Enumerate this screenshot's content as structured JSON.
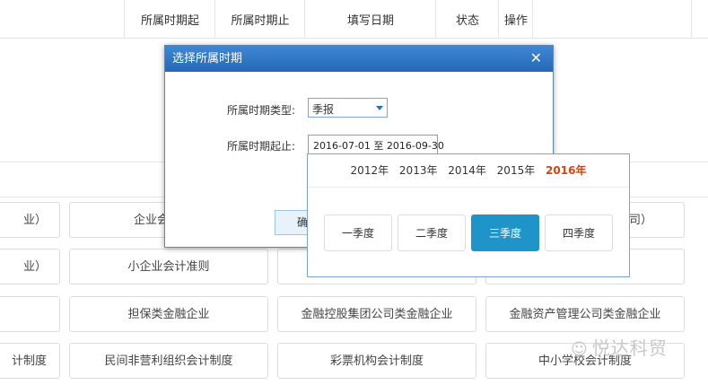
{
  "table_header": {
    "col_start": "所属时期起",
    "col_end": "所属时期止",
    "col_fill_date": "填写日期",
    "col_status": "状态",
    "col_action": "操作"
  },
  "grid": {
    "row1": [
      "业）",
      "企业会计准则",
      "",
      "司）"
    ],
    "row2": [
      "业）",
      "小企业会计准则",
      "",
      ""
    ],
    "row3": [
      "",
      "担保类金融企业",
      "金融控股集团公司类金融企业",
      "金融资产管理公司类金融企业"
    ],
    "row4": [
      "计制度",
      "民间非营利组织会计制度",
      "彩票机构会计制度",
      "中小学校会计制度"
    ]
  },
  "watermark": {
    "text": "悦达科贸"
  },
  "dialog": {
    "title": "选择所属时期",
    "close_label": "✕",
    "period_type_label": "所属时期类型:",
    "period_type_value": "季报",
    "period_range_label": "所属时期起止:",
    "period_range_value": "2016-07-01 至 2016-09-30",
    "confirm_label": "确"
  },
  "quarter_picker": {
    "years": [
      "2012年",
      "2013年",
      "2014年",
      "2015年",
      "2016年"
    ],
    "selected_year": "2016年",
    "quarters": [
      "一季度",
      "二季度",
      "三季度",
      "四季度"
    ],
    "selected_quarter": "三季度"
  },
  "colors": {
    "title_bar": "#2c72c4",
    "active_quarter": "#1f94c9",
    "active_year": "#d64310"
  }
}
